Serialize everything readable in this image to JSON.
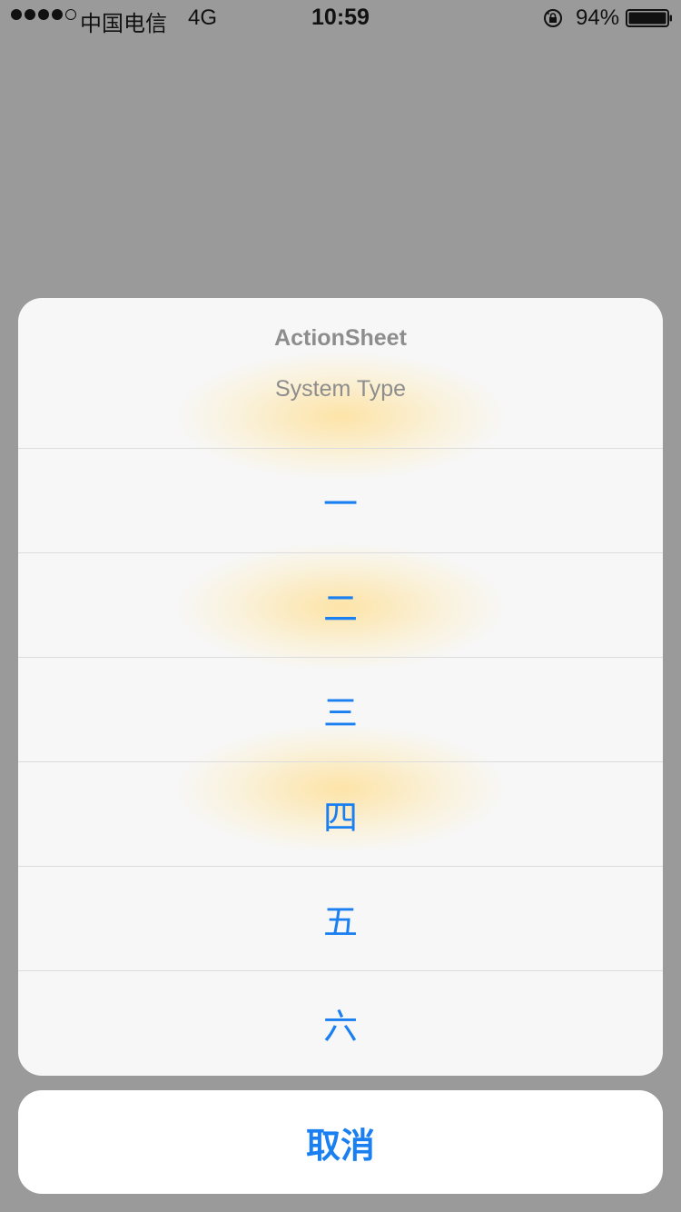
{
  "status_bar": {
    "carrier": "中国电信",
    "network": "4G",
    "time": "10:59",
    "battery_percent": "94%",
    "signal_bars_filled": 4,
    "signal_bars_total": 5
  },
  "action_sheet": {
    "title": "ActionSheet",
    "message": "System Type",
    "options": [
      "一",
      "二",
      "三",
      "四",
      "五",
      "六"
    ],
    "cancel_label": "取消"
  },
  "colors": {
    "overlay": "#9a9a9a",
    "sheet_bg": "#f7f7f7",
    "accent": "#1a7ff0",
    "header_text": "#8d8d8d"
  }
}
